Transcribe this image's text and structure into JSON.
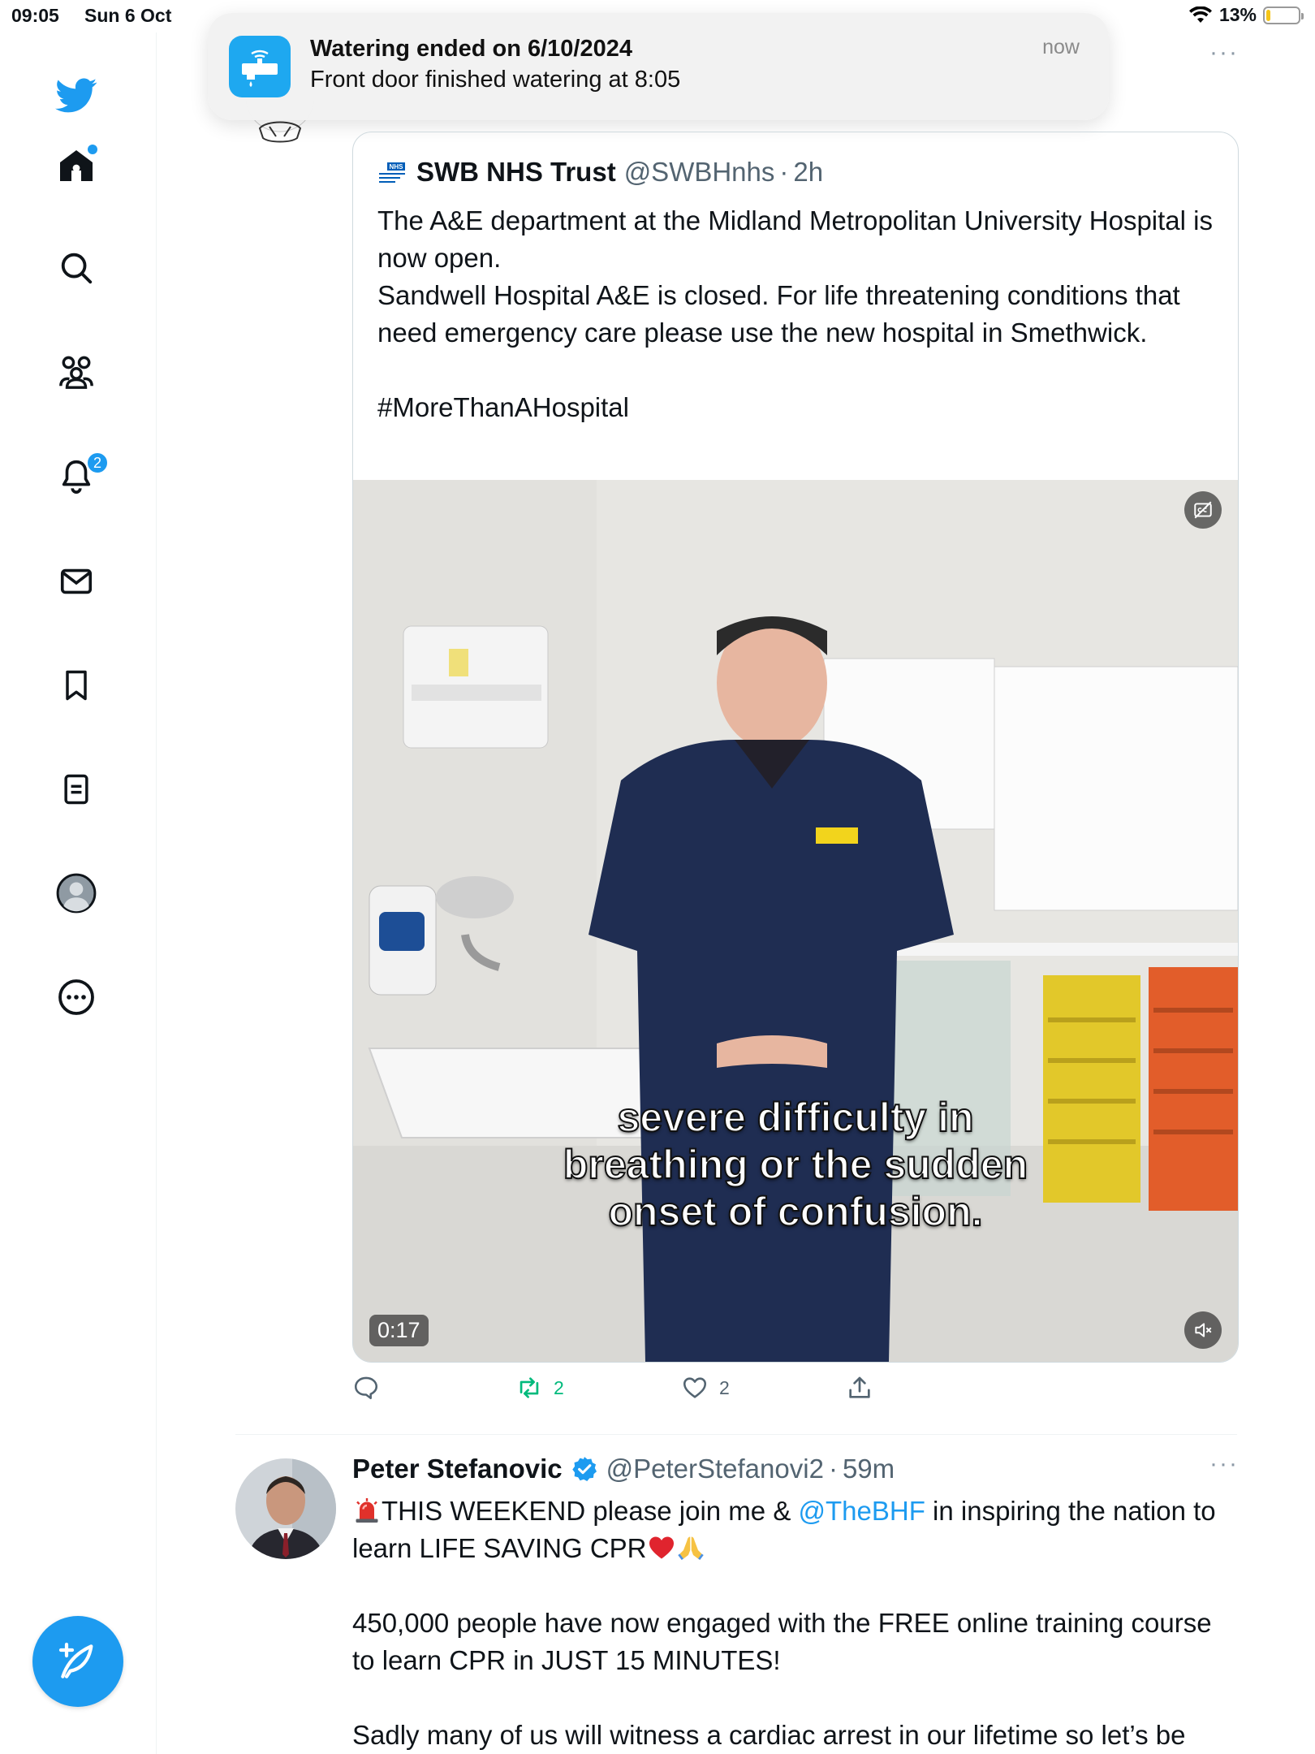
{
  "status_bar": {
    "time": "09:05",
    "date": "Sun 6 Oct",
    "battery": "13%",
    "battery_level": 0.13
  },
  "sidebar": {
    "items": [
      {
        "icon": "twitter-bird-icon"
      },
      {
        "icon": "home-icon",
        "has_dot": true
      },
      {
        "icon": "search-icon"
      },
      {
        "icon": "communities-icon"
      },
      {
        "icon": "notifications-icon",
        "badge": "2"
      },
      {
        "icon": "messages-icon"
      },
      {
        "icon": "bookmarks-icon"
      },
      {
        "icon": "lists-icon"
      },
      {
        "icon": "profile-icon"
      },
      {
        "icon": "more-icon"
      }
    ],
    "compose_icon": "compose-icon"
  },
  "notification": {
    "title": "Watering ended on 6/10/2024",
    "body": "Front door finished watering at 8:05",
    "time": "now"
  },
  "quoted_tweet": {
    "name": "SWB NHS Trust",
    "handle": "@SWBHnhs",
    "separator": "·",
    "time": "2h",
    "text": "The A&E department at the Midland Metropolitan University Hospital is now open.\nSandwell Hospital A&E is closed. For life threatening conditions that need emergency care please use the new hospital in Smethwick.\n\n#MoreThanAHospital",
    "video": {
      "caption_line1": "severe difficulty in",
      "caption_line2": "breathing or the sudden",
      "caption_line3": "onset of confusion.",
      "duration": "0:17"
    }
  },
  "actions": {
    "reply_count": "",
    "retweet_count": "2",
    "like_count": "2"
  },
  "tweet": {
    "name": "Peter Stefanovic",
    "handle": "@PeterStefanovi2",
    "separator": "·",
    "time": "59m",
    "line1_pre": "THIS WEEKEND please join me & ",
    "mention": "@TheBHF",
    "line1_post": " in inspiring the nation to learn LIFE SAVING CPR",
    "para2": "450,000 people have now engaged with the FREE online training course to learn CPR in JUST 15 MINUTES!",
    "para3": "Sadly many of us will witness a cardiac arrest in our lifetime so let’s be"
  },
  "colors": {
    "accent": "#1d9bf0",
    "retweet": "#00ba7c",
    "muted": "#536471"
  }
}
